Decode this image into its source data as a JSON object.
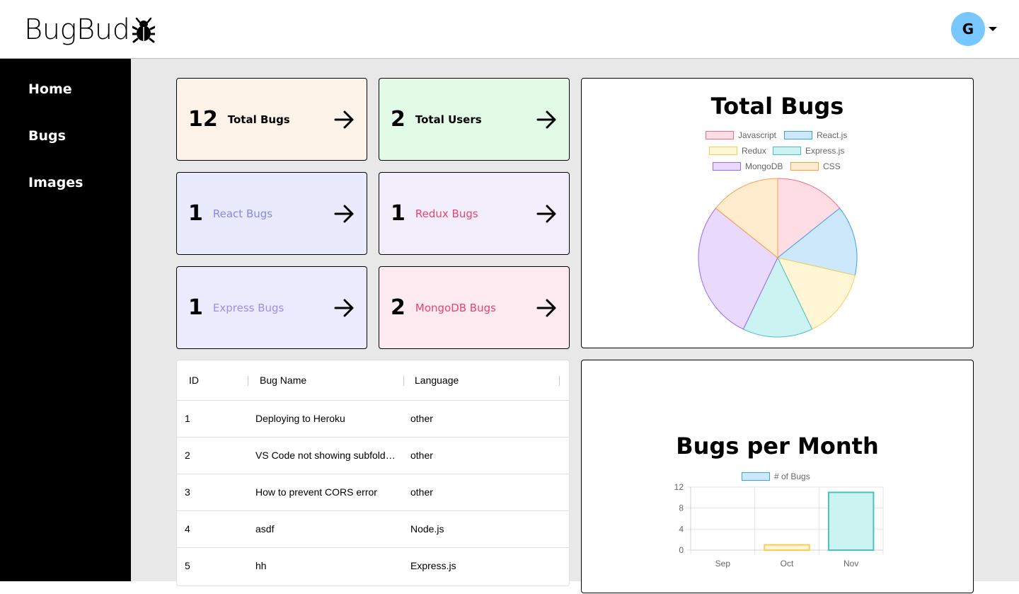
{
  "header": {
    "logo_text": "BugBud",
    "avatar_letter": "G"
  },
  "sidebar": {
    "items": [
      {
        "label": "Home"
      },
      {
        "label": "Bugs"
      },
      {
        "label": "Images"
      }
    ]
  },
  "cards": [
    {
      "count": "12",
      "label": "Total Bugs",
      "bg": "#fdf3e8",
      "label_color": "#000000"
    },
    {
      "count": "2",
      "label": "Total Users",
      "bg": "#e2fbe6",
      "label_color": "#000000"
    },
    {
      "count": "1",
      "label": "React Bugs",
      "bg": "#e9eafc",
      "label_color": "#8b87e6"
    },
    {
      "count": "1",
      "label": "Redux Bugs",
      "bg": "#f3eefc",
      "label_color": "#e8446f"
    },
    {
      "count": "1",
      "label": "Express Bugs",
      "bg": "#ecebfd",
      "label_color": "#9b8fee"
    },
    {
      "count": "2",
      "label": "MongoDB Bugs",
      "bg": "#fdebf1",
      "label_color": "#e8446f"
    }
  ],
  "pie_panel": {
    "title": "Total Bugs"
  },
  "bar_panel": {
    "title": "Bugs per Month"
  },
  "table": {
    "headers": [
      "ID",
      "Bug Name",
      "Language"
    ],
    "rows": [
      {
        "id": "1",
        "name": "Deploying to Heroku",
        "language": "other"
      },
      {
        "id": "2",
        "name": "VS Code not showing subfolders",
        "language": "other"
      },
      {
        "id": "3",
        "name": "How to prevent CORS error",
        "language": "other"
      },
      {
        "id": "4",
        "name": "asdf",
        "language": "Node.js"
      },
      {
        "id": "5",
        "name": "hh",
        "language": "Express.js"
      }
    ]
  },
  "chart_data": [
    {
      "type": "pie",
      "title": "Total Bugs",
      "labels": [
        "Javascript",
        "React.js",
        "Redux",
        "Express.js",
        "MongoDB",
        "CSS"
      ],
      "values": [
        1,
        1,
        1,
        1,
        2,
        1
      ],
      "colors": [
        {
          "fill": "#ffdde4",
          "stroke": "#ff6384"
        },
        {
          "fill": "#cde8fb",
          "stroke": "#36a2eb"
        },
        {
          "fill": "#fff6d6",
          "stroke": "#ffcd56"
        },
        {
          "fill": "#cbf3f1",
          "stroke": "#4bc0c0"
        },
        {
          "fill": "#e8d9fd",
          "stroke": "#9966ff"
        },
        {
          "fill": "#ffebcd",
          "stroke": "#ff9f40"
        }
      ],
      "legend_position": "top"
    },
    {
      "type": "bar",
      "title": "Bugs per Month",
      "categories": [
        "Sep",
        "Oct",
        "Nov"
      ],
      "series": [
        {
          "name": "# of Bugs",
          "values": [
            0,
            1,
            11
          ]
        }
      ],
      "bar_colors": [
        {
          "fill": "#ffdde4",
          "stroke": "#ff6384"
        },
        {
          "fill": "#fff6d6",
          "stroke": "#ffcd56"
        },
        {
          "fill": "#cbf3f1",
          "stroke": "#4bc0c0"
        }
      ],
      "legend_color": {
        "fill": "#cde8fb",
        "stroke": "#36a2eb"
      },
      "ylim": [
        0,
        12
      ],
      "yticks": [
        0,
        4,
        8,
        12
      ],
      "grid": true,
      "legend_position": "top"
    }
  ]
}
